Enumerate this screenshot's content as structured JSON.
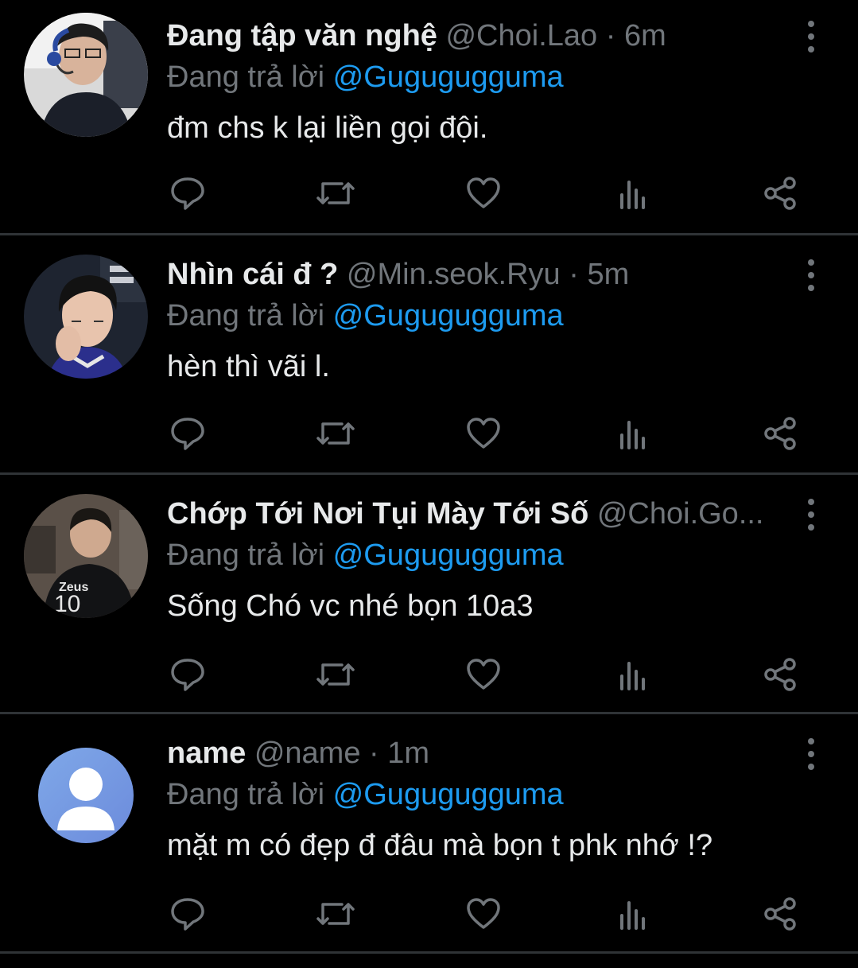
{
  "tweets": [
    {
      "display_name": "Đang tập văn nghệ",
      "handle": "@Choi.Lao",
      "separator": "·",
      "time": "6m",
      "reply_prefix": "Đang trả lời",
      "reply_to": "@Gugugugguma",
      "text": "đm chs k lại liền gọi đội.",
      "avatar": "photo-person-headset"
    },
    {
      "display_name": "Nhìn cái đ ?",
      "handle": "@Min.seok.Ryu",
      "separator": "·",
      "time": "5m",
      "reply_prefix": "Đang trả lời",
      "reply_to": "@Gugugugguma",
      "text": "hèn thì vãi l.",
      "avatar": "photo-person-hand-on-chin"
    },
    {
      "display_name": "Chớp Tới Nơi Tụi Mày Tới Số",
      "handle": "@Choi.Go...",
      "separator": "",
      "time": "",
      "reply_prefix": "Đang trả lời",
      "reply_to": "@Gugugugguma",
      "text": "Sống Chó vc nhé bọn 10a3",
      "avatar": "photo-jersey-zeus-10",
      "jersey_text": "Zeus",
      "jersey_number": "10"
    },
    {
      "display_name": "name",
      "handle": "@name",
      "separator": "·",
      "time": "1m",
      "reply_prefix": "Đang trả lời",
      "reply_to": "@Gugugugguma",
      "text": "mặt m có đẹp đ đâu mà bọn t phk nhớ !?",
      "avatar": "default-user-icon"
    }
  ],
  "action_icons": [
    "reply-icon",
    "retweet-icon",
    "like-icon",
    "views-icon",
    "share-icon"
  ],
  "colors": {
    "background": "#000000",
    "text": "#e7e9ea",
    "muted": "#71767b",
    "link": "#1d9bf0",
    "divider": "#2f3336"
  }
}
